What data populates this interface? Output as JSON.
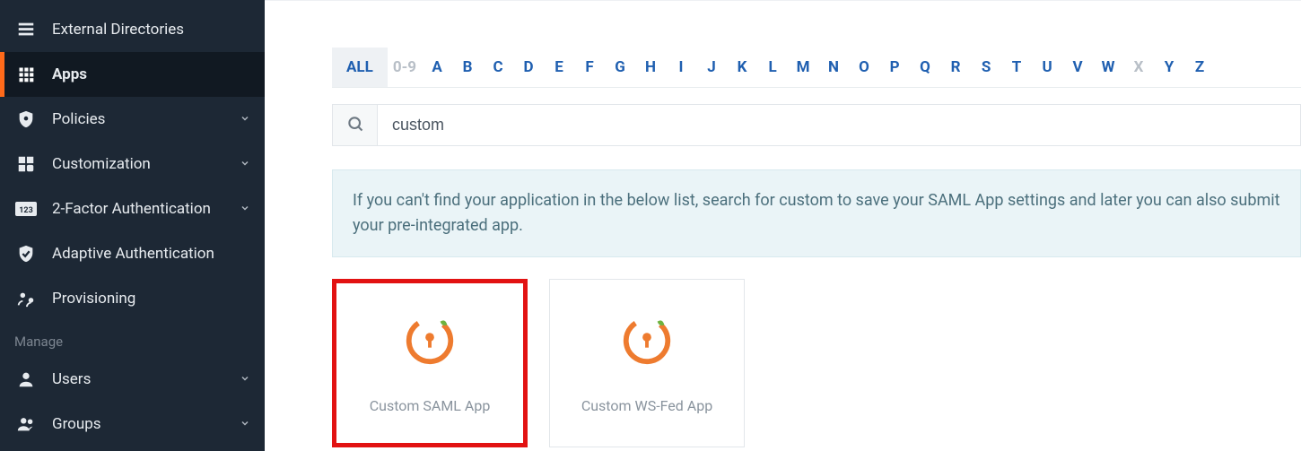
{
  "sidebar": {
    "items": [
      {
        "label": "External Directories",
        "icon": "stack-icon",
        "expandable": false
      },
      {
        "label": "Apps",
        "icon": "grid-icon",
        "expandable": false,
        "active": true
      },
      {
        "label": "Policies",
        "icon": "shield-gear-icon",
        "expandable": true
      },
      {
        "label": "Customization",
        "icon": "puzzle-icon",
        "expandable": true
      },
      {
        "label": "2-Factor Authentication",
        "icon": "badge-123-icon",
        "expandable": true
      },
      {
        "label": "Adaptive Authentication",
        "icon": "shield-check-icon",
        "expandable": false
      },
      {
        "label": "Provisioning",
        "icon": "people-cycle-icon",
        "expandable": false
      }
    ],
    "section_label": "Manage",
    "manage_items": [
      {
        "label": "Users",
        "icon": "user-icon",
        "expandable": true
      },
      {
        "label": "Groups",
        "icon": "users-icon",
        "expandable": true
      }
    ]
  },
  "alpha_filter": {
    "active": "ALL",
    "tabs": [
      "ALL",
      "0-9",
      "A",
      "B",
      "C",
      "D",
      "E",
      "F",
      "G",
      "H",
      "I",
      "J",
      "K",
      "L",
      "M",
      "N",
      "O",
      "P",
      "Q",
      "R",
      "S",
      "T",
      "U",
      "V",
      "W",
      "X",
      "Y",
      "Z"
    ],
    "disabled": [
      "0-9",
      "X"
    ]
  },
  "search": {
    "value": "custom",
    "placeholder": ""
  },
  "info_banner": "If you can't find your application in the below list, search for custom to save your SAML App settings and later you can also submit your pre-integrated app.",
  "cards": [
    {
      "label": "Custom SAML App",
      "highlight": true
    },
    {
      "label": "Custom WS-Fed App",
      "highlight": false
    }
  ],
  "colors": {
    "accent_orange": "#ff6a1a",
    "link_blue": "#1f5fb0",
    "sidebar_bg": "#1d2835",
    "highlight_red": "#e21212"
  }
}
